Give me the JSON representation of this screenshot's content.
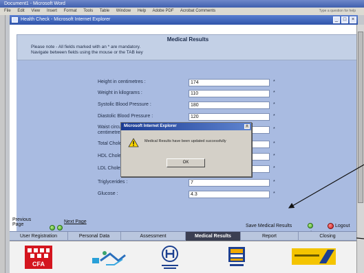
{
  "outer_window": {
    "title": "Document1 - Microsoft Word",
    "menu": [
      "File",
      "Edit",
      "View",
      "Insert",
      "Format",
      "Tools",
      "Table",
      "Window",
      "Help",
      "Adobe PDF",
      "Acrobat Comments"
    ],
    "question_text": "Type a question for help"
  },
  "ie_window": {
    "title": "Health Check - Microsoft Internet Explorer",
    "minimize": "_",
    "maximize": "□",
    "close": "×"
  },
  "page": {
    "title": "Medical Results",
    "note_line1": "Please note - All fields marked with an * are mandatory.",
    "note_line2": "Navigate between fields using the mouse or the TAB key"
  },
  "fields": [
    {
      "label": "Height in centimetres :",
      "value": "174"
    },
    {
      "label": "Weight in kilograms :",
      "value": "110"
    },
    {
      "label": "Systolic Blood Pressure :",
      "value": "180"
    },
    {
      "label": "Diastolic Blood Pressure :",
      "value": "120"
    },
    {
      "label": "Waist circumference in",
      "value": ""
    },
    {
      "label": "centimetres :",
      "value": ""
    },
    {
      "label": "Total Cholesterol :",
      "value": ""
    },
    {
      "label": "HDL Cholesterol :",
      "value": ""
    },
    {
      "label": "LDL Cholesterol :",
      "value": ""
    },
    {
      "label": "Triglycerides :",
      "value": "7"
    },
    {
      "label": "Glucose :",
      "value": "4.3"
    }
  ],
  "required_mark": "*",
  "dialog": {
    "title": "Microsoft Internet Explorer",
    "message": "Medical Results have been updated successfully",
    "ok_label": "OK",
    "close": "x"
  },
  "nav": {
    "previous_line1": "Previous",
    "previous_line2": "Page",
    "next": "Next Page",
    "save": "Save Medical Results",
    "logout": "Logout"
  },
  "tabs": [
    "User Registration",
    "Personal Data",
    "Assessment",
    "Medical Results",
    "Report",
    "Closing"
  ],
  "active_tab": "Medical Results",
  "logos": [
    "CFA",
    "Heart",
    "Bank",
    "SES",
    "Bank2"
  ],
  "colors": {
    "panel": "#a9bbe1",
    "header": "#c3d0e6",
    "active_tab": "#3b3f52"
  }
}
